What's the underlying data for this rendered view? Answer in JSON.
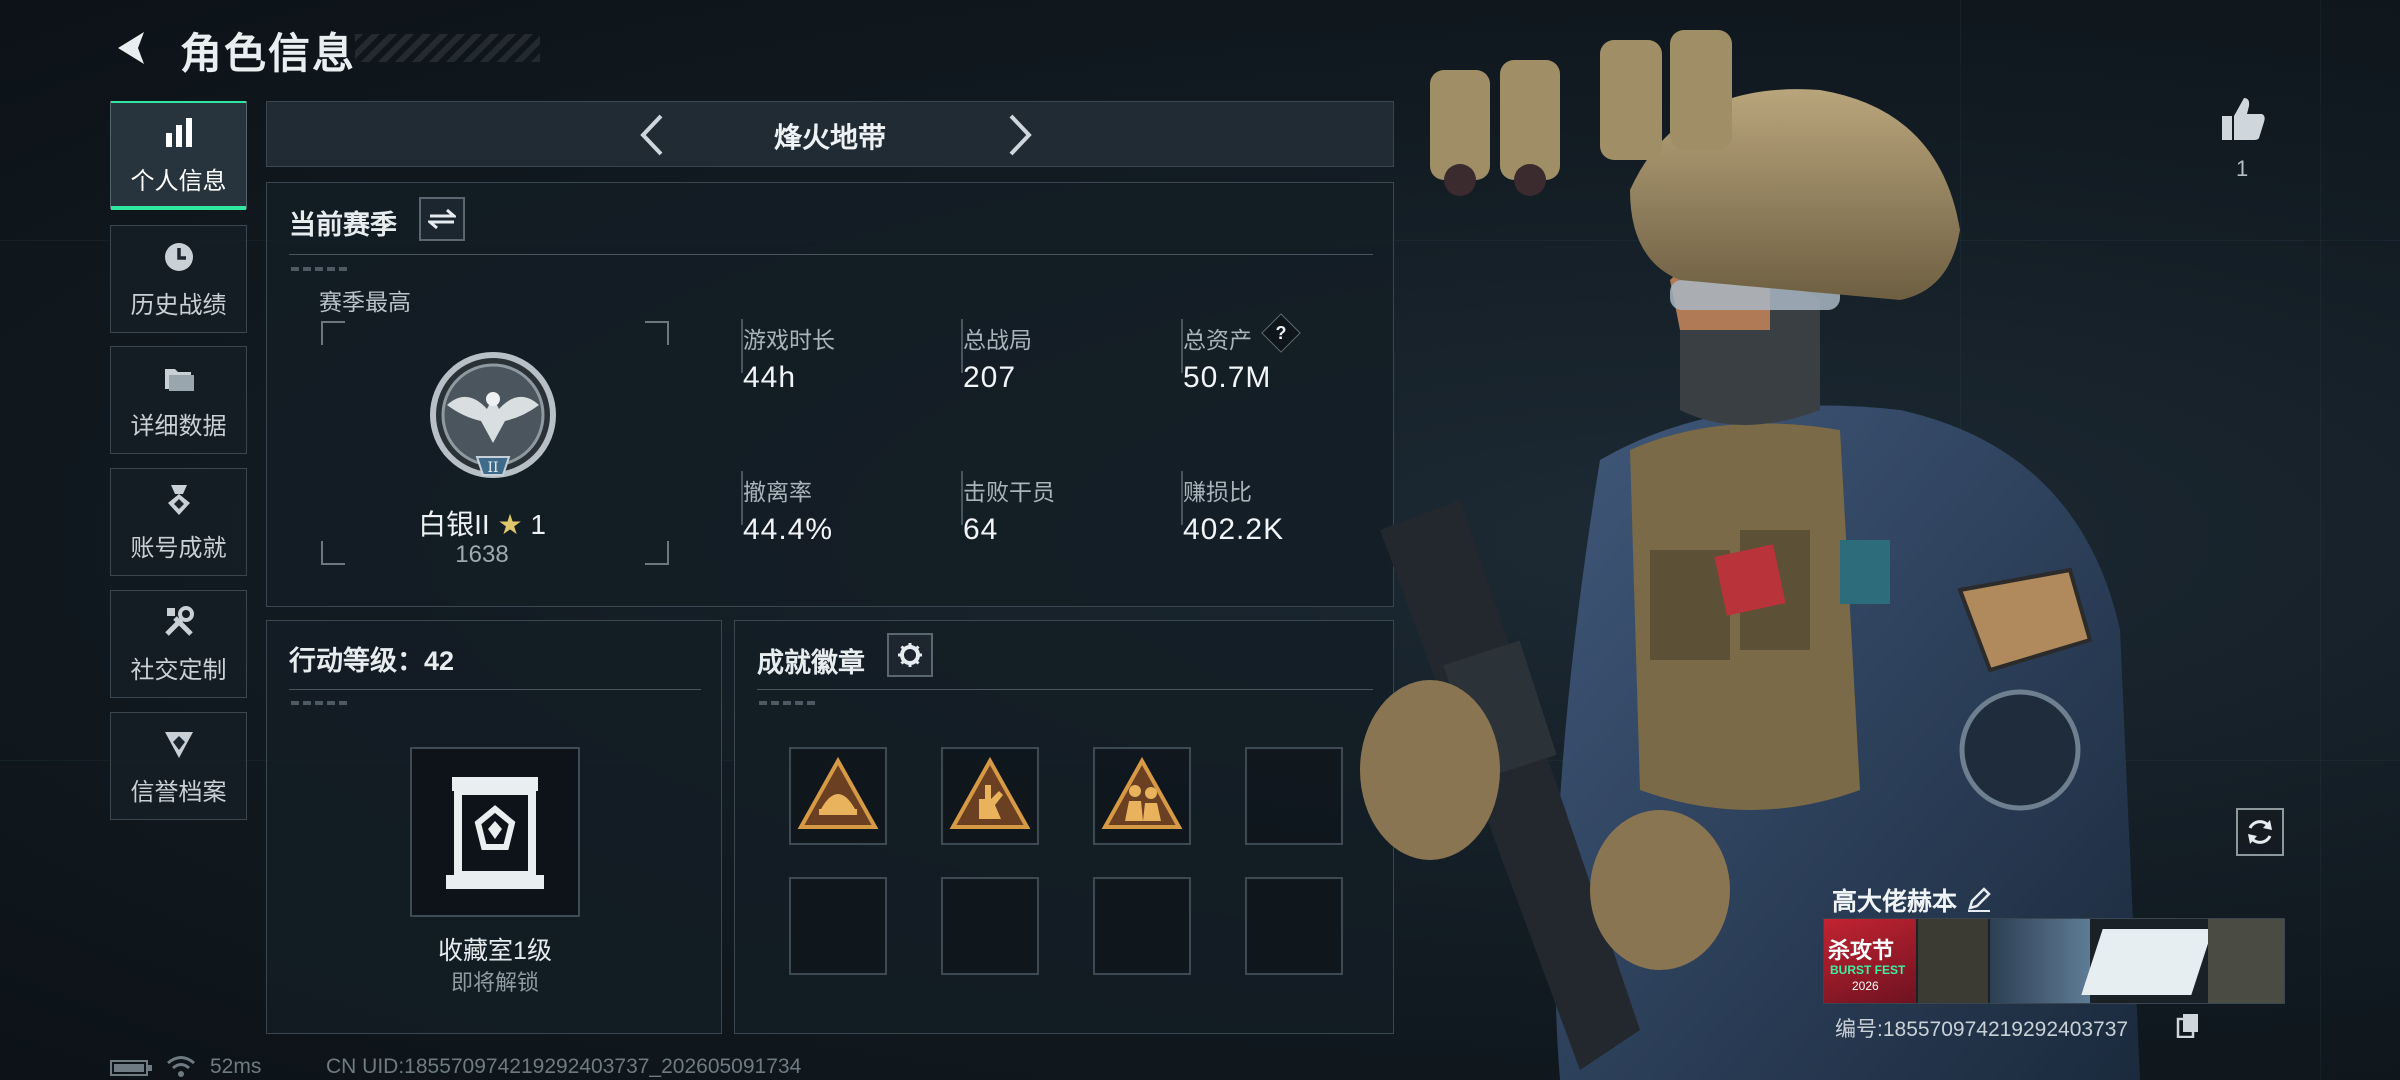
{
  "header": {
    "title": "角色信息"
  },
  "nav": {
    "items": [
      {
        "label": "个人信息",
        "active": true,
        "icon": "bar-chart-icon"
      },
      {
        "label": "历史战绩",
        "active": false,
        "icon": "clock-icon"
      },
      {
        "label": "详细数据",
        "active": false,
        "icon": "folder-icon"
      },
      {
        "label": "账号成就",
        "active": false,
        "icon": "medal-icon"
      },
      {
        "label": "社交定制",
        "active": false,
        "icon": "tools-icon"
      },
      {
        "label": "信誉档案",
        "active": false,
        "icon": "shield-diamond-icon"
      }
    ]
  },
  "mode": {
    "title": "烽火地带"
  },
  "season": {
    "section_title": "当前赛季",
    "best_label": "赛季最高",
    "rank_name": "白银II",
    "rank_stars": "1",
    "rank_score": "1638",
    "rank_badge_numeral": "II",
    "stats": [
      {
        "label": "游戏时长",
        "value": "44h"
      },
      {
        "label": "总战局",
        "value": "207"
      },
      {
        "label": "总资产",
        "value": "50.7M"
      },
      {
        "label": "撤离率",
        "value": "44.4%"
      },
      {
        "label": "击败干员",
        "value": "64"
      },
      {
        "label": "赚损比",
        "value": "402.2K"
      }
    ],
    "help_glyph": "?"
  },
  "action_level": {
    "title": "行动等级：42",
    "collection_label": "收藏室1级",
    "collection_status": "即将解锁"
  },
  "achievements": {
    "title": "成就徽章",
    "filled_slots": 3,
    "total_slots": 8
  },
  "player": {
    "likes": "1",
    "name": "高大佬赫本",
    "id_text": "编号:18557097421929240373​7",
    "card_text_1": "杀攻节",
    "card_text_2": "BURST FEST",
    "card_text_3": "2026"
  },
  "footer": {
    "ping": "52ms",
    "uid": "CN UID:18557097421929240373​7_202605091734"
  },
  "colors": {
    "accent": "#2fe7a1",
    "panel": "#141d24",
    "border": "#3b4750"
  }
}
